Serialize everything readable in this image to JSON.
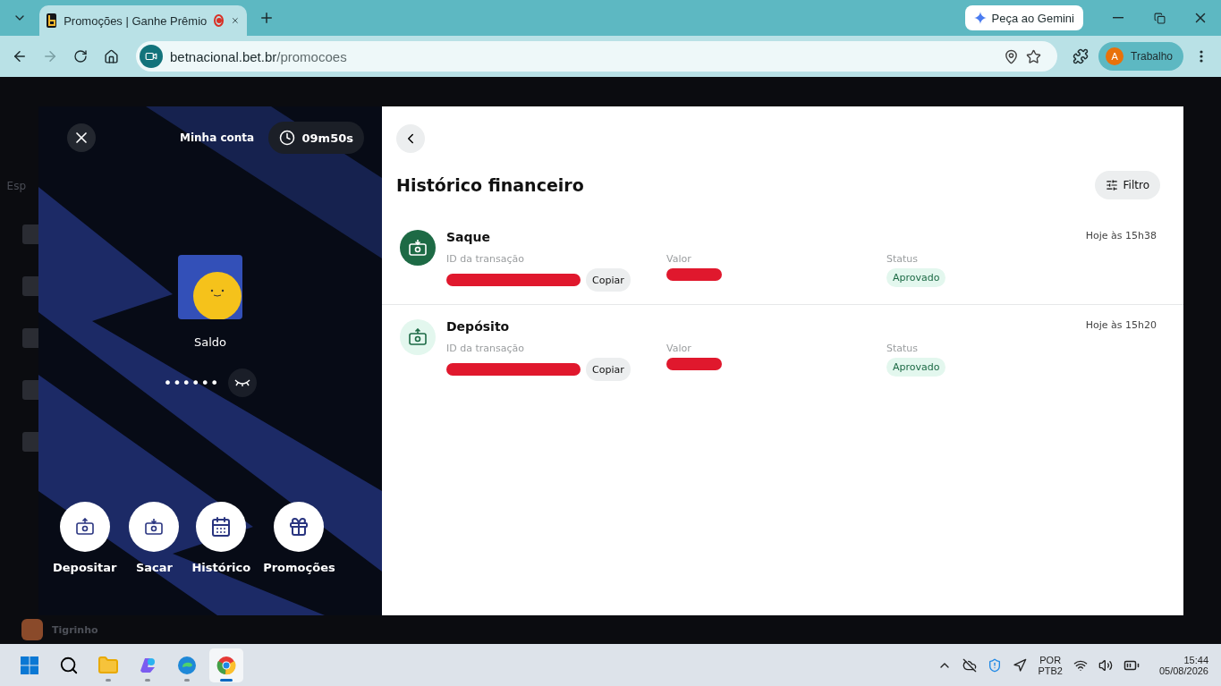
{
  "browser": {
    "tab_title": "Promoções | Ganhe Prêmio",
    "url_domain": "betnacional.bet.br",
    "url_path": "/promocoes",
    "gemini_button": "Peça ao Gemini",
    "profile": {
      "initial": "A",
      "name": "Trabalho"
    }
  },
  "site_sidebar": {
    "label": "Esp",
    "bottom_item": "Tigrinho"
  },
  "account_panel": {
    "title": "Minha conta",
    "timer": "09m50s",
    "balance_label": "Saldo",
    "balance_masked": "••••••",
    "actions": [
      {
        "label": "Depositar",
        "kind": "deposit"
      },
      {
        "label": "Sacar",
        "kind": "withdraw"
      },
      {
        "label": "Histórico",
        "kind": "history"
      },
      {
        "label": "Promoções",
        "kind": "gift"
      }
    ]
  },
  "history": {
    "title": "Histórico financeiro",
    "filter_button": "Filtro",
    "transactions": [
      {
        "type": "Saque",
        "kind": "withdraw",
        "time": "Hoje às 15h38",
        "id_label": "ID da transação",
        "copy_button": "Copiar",
        "value_label": "Valor",
        "status_label": "Status",
        "status": "Aprovado"
      },
      {
        "type": "Depósito",
        "kind": "deposit",
        "time": "Hoje às 15h20",
        "id_label": "ID da transação",
        "copy_button": "Copiar",
        "value_label": "Valor",
        "status_label": "Status",
        "status": "Aprovado"
      }
    ]
  },
  "taskbar": {
    "apps": [
      {
        "kind": "files",
        "selected": false
      },
      {
        "kind": "copilot",
        "selected": false
      },
      {
        "kind": "edge",
        "selected": false
      },
      {
        "kind": "chrome",
        "selected": true
      }
    ],
    "language": "POR",
    "layout": "PTB2",
    "time": "15:44",
    "date": "05/08/2026"
  }
}
